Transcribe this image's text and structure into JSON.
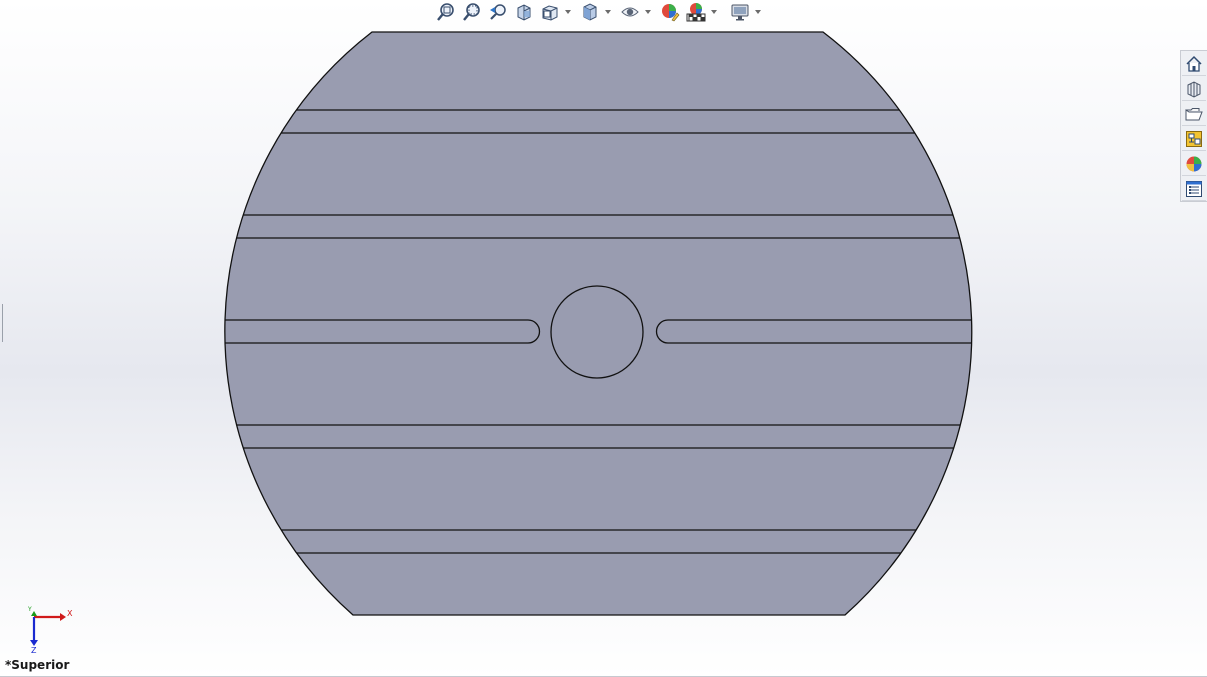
{
  "toolbar": {
    "items": [
      {
        "icon": "zoom-to-fit-icon"
      },
      {
        "icon": "zoom-to-area-icon"
      },
      {
        "icon": "previous-view-icon"
      },
      {
        "icon": "section-view-icon"
      },
      {
        "icon": "view-orientation-icon",
        "dropdown": true
      },
      {
        "icon": "display-style-icon",
        "dropdown": true
      },
      {
        "icon": "hide-show-items-icon",
        "dropdown": true
      },
      {
        "icon": "edit-appearance-icon"
      },
      {
        "icon": "apply-scene-icon",
        "dropdown": true
      },
      {
        "icon": "view-settings-icon",
        "dropdown": true
      }
    ]
  },
  "taskpane": {
    "items": [
      {
        "icon": "home-icon"
      },
      {
        "icon": "design-library-icon"
      },
      {
        "icon": "file-explorer-icon"
      },
      {
        "icon": "view-palette-icon"
      },
      {
        "icon": "appearances-icon"
      },
      {
        "icon": "custom-properties-icon"
      }
    ]
  },
  "model": {
    "face_color": "#999cb0",
    "edge_color": "#111111"
  },
  "triad": {
    "x_label": "X",
    "y_label": "Y",
    "z_label": "Z",
    "x_color": "#d01a1a",
    "y_color": "#1a9a1a",
    "z_color": "#1a2ad0"
  },
  "view": {
    "name": "*Superior"
  }
}
